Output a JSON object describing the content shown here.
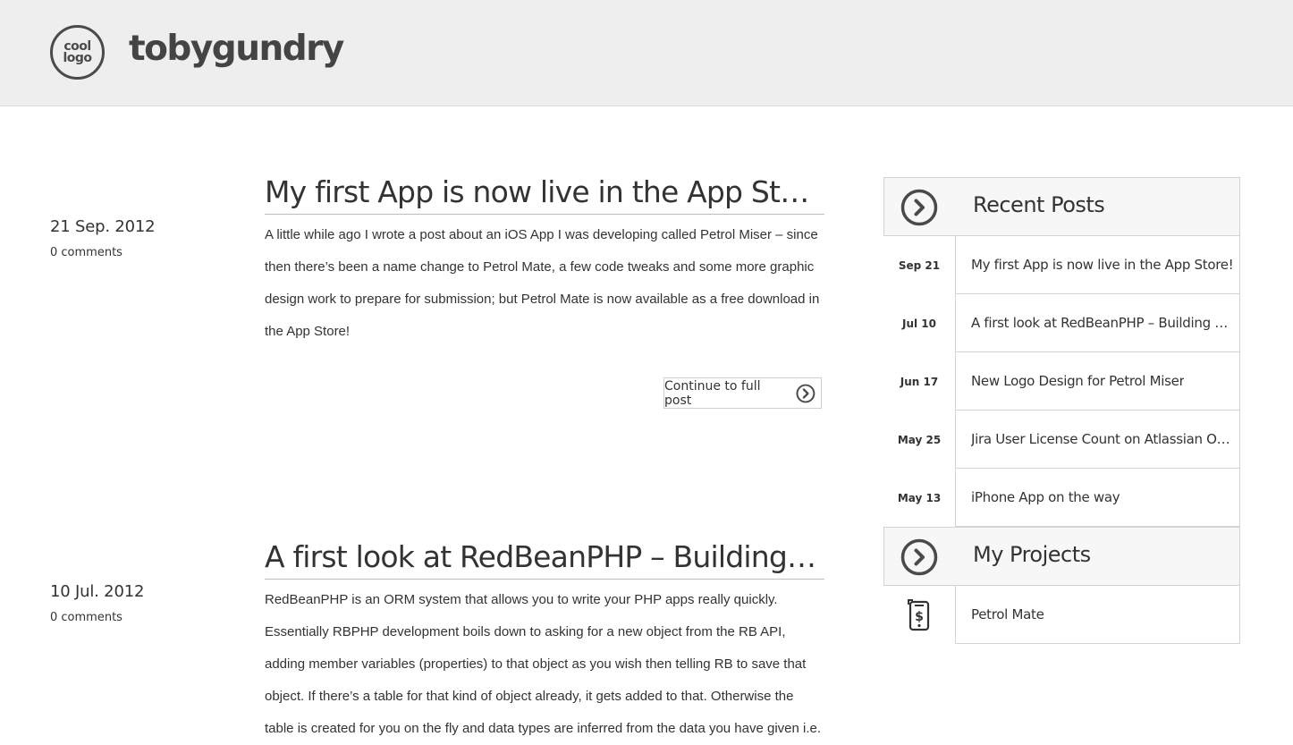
{
  "header": {
    "logo_line1": "cool",
    "logo_line2": "logo",
    "site_title": "tobygundry"
  },
  "posts": [
    {
      "title": "My first App is now live in the App Store!",
      "date": "21 Sep. 2012",
      "comments": "0 comments",
      "excerpt": "A little while ago I wrote a post about an iOS App I was developing called Petrol Miser – since then there’s been a name change to Petrol Mate, a few code tweaks and some more graphic design work to prepare for submission; but Petrol Mate is now available as a free download in the App Store!",
      "continue_label": "Continue to full post"
    },
    {
      "title": "A first look at RedBeanPHP – Building…",
      "date": "10 Jul. 2012",
      "comments": "0 comments",
      "excerpt": "RedBeanPHP is an ORM system that allows you to write your PHP apps really quickly. Essentially RBPHP development boils down to asking for a new object from the RB API, adding member variables (properties) to that object as you wish then telling RB to save that object. If there’s a table for that kind of object already, it gets added to that. Otherwise the table is created for you on the fly and data types are inferred from the data you have given i.e."
    }
  ],
  "sidebar": {
    "recent_posts": {
      "heading": "Recent Posts",
      "items": [
        {
          "date": "Sep 21",
          "title": "My first App is now live in the App Store!"
        },
        {
          "date": "Jul 10",
          "title": "A first look at RedBeanPHP – Building a simple blog"
        },
        {
          "date": "Jun 17",
          "title": "New Logo Design for Petrol Miser"
        },
        {
          "date": "May 25",
          "title": "Jira User License Count on Atlassian OnDemand"
        },
        {
          "date": "May 13",
          "title": "iPhone App on the way"
        }
      ]
    },
    "projects": {
      "heading": "My Projects",
      "items": [
        {
          "icon": "phone-dollar-icon",
          "title": "Petrol Mate"
        }
      ]
    }
  },
  "colors": {
    "header_bg": "#eeeeee",
    "text": "#333333",
    "border": "#d3d3d3",
    "widget_head_bg": "#f7f7f7"
  }
}
